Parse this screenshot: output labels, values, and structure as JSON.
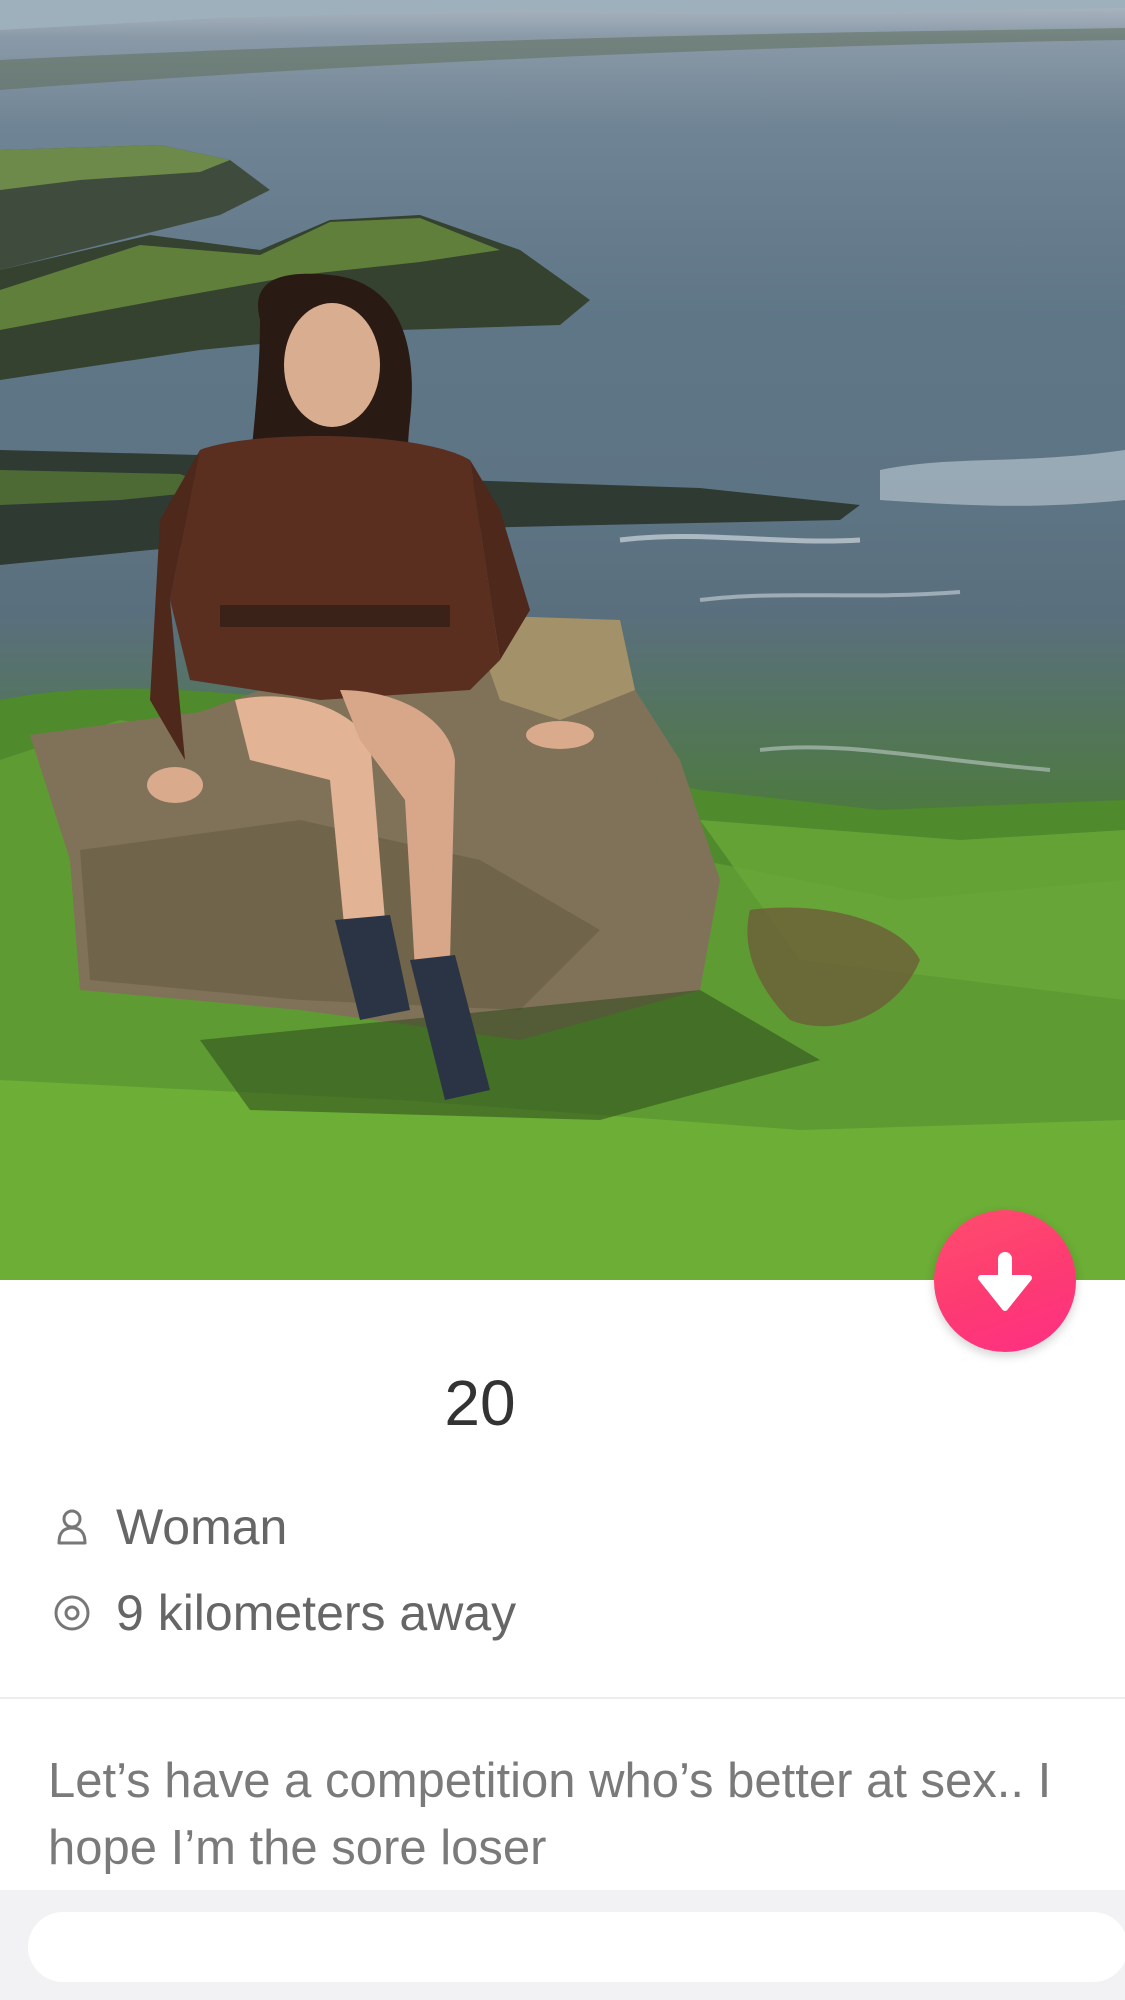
{
  "profile": {
    "photo_icon": "profile-photo",
    "age": "20",
    "gender": "Woman",
    "distance": "9 kilometers away",
    "bio": "Let’s have a competition who’s better at sex.. I hope I’m the sore loser"
  },
  "actions": {
    "collapse_icon": "arrow-down-icon"
  },
  "colors": {
    "accent": "#fd3a73",
    "text_primary": "#333333",
    "text_secondary": "#666666"
  }
}
